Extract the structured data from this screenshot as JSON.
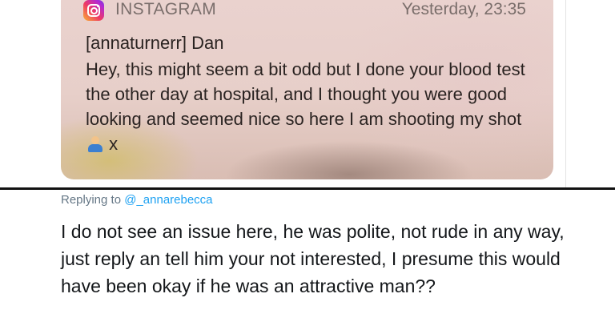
{
  "notification": {
    "app_icon": "instagram-icon",
    "app_name": "INSTAGRAM",
    "timestamp": "Yesterday, 23:35",
    "title": "[annaturnerr] Dan",
    "body": "Hey, this might seem a bit odd but I done your blood test the other day at hospital, and I thought you were good looking and seemed nice so here I am shooting my shot",
    "emoji": "person-shrugging-emoji",
    "body_suffix": " x"
  },
  "reply": {
    "replying_to_label": "Replying to",
    "handle": "@_annarebecca",
    "text": "I do not see an issue here, he was polite,  not rude in any way, just reply an tell him your not interested, I presume this would have been okay if he was an attractive man??"
  },
  "colors": {
    "link": "#1da1f2",
    "meta_gray": "#657786"
  }
}
